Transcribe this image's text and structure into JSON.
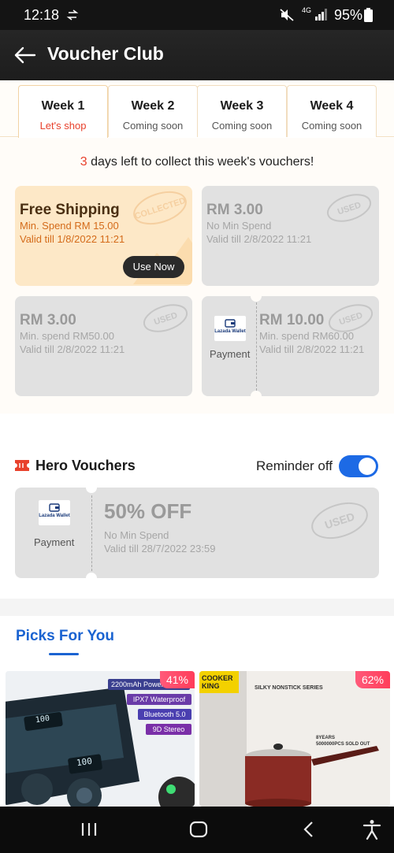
{
  "status_bar": {
    "time": "12:18",
    "network": "4G",
    "battery": "95%"
  },
  "app_bar": {
    "title": "Voucher Club"
  },
  "tabs": [
    {
      "label": "Week 1",
      "status": "Let's shop"
    },
    {
      "label": "Week 2",
      "status": "Coming soon"
    },
    {
      "label": "Week 3",
      "status": "Coming soon"
    },
    {
      "label": "Week 4",
      "status": "Coming soon"
    }
  ],
  "days_left": {
    "count": "3",
    "text": " days left to collect this week's vouchers!"
  },
  "vouchers": [
    {
      "title": "Free Shipping",
      "min_spend": "Min. Spend RM 15.00",
      "valid": "Valid till 1/8/2022 11:21",
      "stamp": "COLLECTED",
      "action": "Use Now"
    },
    {
      "title": "RM 3.00",
      "min_spend": "No Min Spend",
      "valid": "Valid till 2/8/2022 11:21",
      "stamp": "USED"
    },
    {
      "title": "RM 3.00",
      "min_spend": "Min. spend RM50.00",
      "valid": "Valid till 2/8/2022 11:21",
      "stamp": "USED"
    },
    {
      "title": "RM 10.00",
      "min_spend": "Min. spend RM60.00",
      "valid": "Valid till 2/8/2022 11:21",
      "stamp": "USED",
      "payment_label": "Payment",
      "wallet_text": "Lazada Wallet"
    }
  ],
  "hero": {
    "title": "Hero Vouchers",
    "reminder_label": "Reminder off",
    "voucher": {
      "title": "50% OFF",
      "min_spend": "No Min Spend",
      "valid": "Valid till 28/7/2022 23:59",
      "stamp": "USED",
      "payment_label": "Payment",
      "wallet_text": "Lazada Wallet"
    }
  },
  "picks": {
    "title": "Picks For You"
  },
  "products": [
    {
      "discount": "41%",
      "features": [
        "2200mAh Power",
        "IPX7 Waterproof",
        "Bluetooth 5.0",
        "9D Stereo"
      ],
      "display": "100"
    },
    {
      "discount": "62%",
      "brand": "COOKER KING",
      "series": "SILKY NONSTICK SERIES",
      "claim_1": "8YEARS",
      "claim_2": "5000000PCS SOLD OUT"
    }
  ],
  "colors": {
    "accent": "#e8412c",
    "blue": "#1a63d1",
    "toggle": "#1d6ae5"
  }
}
